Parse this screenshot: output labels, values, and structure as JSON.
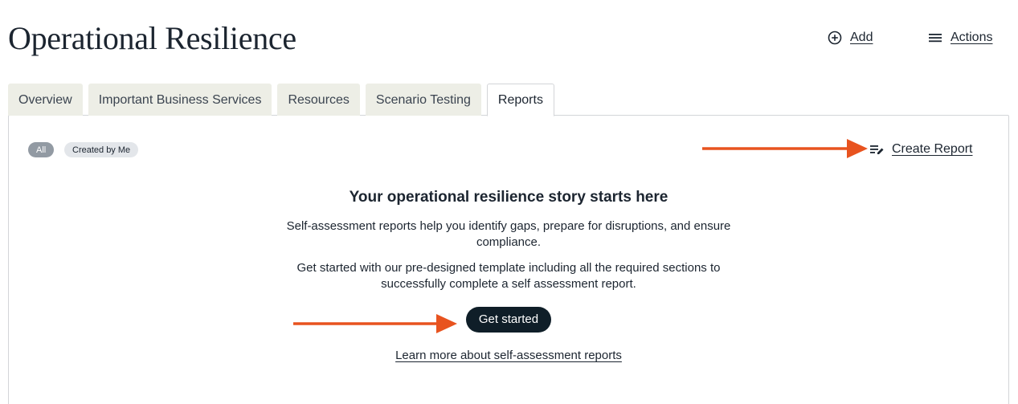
{
  "page": {
    "title": "Operational Resilience"
  },
  "header": {
    "add_label": "Add",
    "add_icon": "plus-circle-icon",
    "actions_label": "Actions",
    "actions_icon": "hamburger-menu-icon"
  },
  "tabs": [
    {
      "label": "Overview",
      "active": false
    },
    {
      "label": "Important Business Services",
      "active": false
    },
    {
      "label": "Resources",
      "active": false
    },
    {
      "label": "Scenario Testing",
      "active": false
    },
    {
      "label": "Reports",
      "active": true
    }
  ],
  "filters": {
    "chips": [
      {
        "label": "All",
        "selected": true
      },
      {
        "label": "Created by Me",
        "selected": false
      }
    ]
  },
  "create_report": {
    "label": "Create Report",
    "icon": "edit-list-icon"
  },
  "empty_state": {
    "heading": "Your operational resilience story starts here",
    "paragraph_1": "Self-assessment reports help you identify gaps, prepare for disruptions, and ensure compliance.",
    "paragraph_2": "Get started with our pre-designed template including all the required sections to successfully complete a self assessment report.",
    "cta_label": "Get started",
    "learn_more_label": "Learn more about self-assessment reports"
  },
  "colors": {
    "annotation_arrow": "#e8531f",
    "primary_button": "#0f1e28",
    "text": "#1c2530",
    "tab_inactive_bg": "#edeee6",
    "chip_selected_bg": "#929aa3",
    "chip_bg": "#e3e6ea"
  }
}
